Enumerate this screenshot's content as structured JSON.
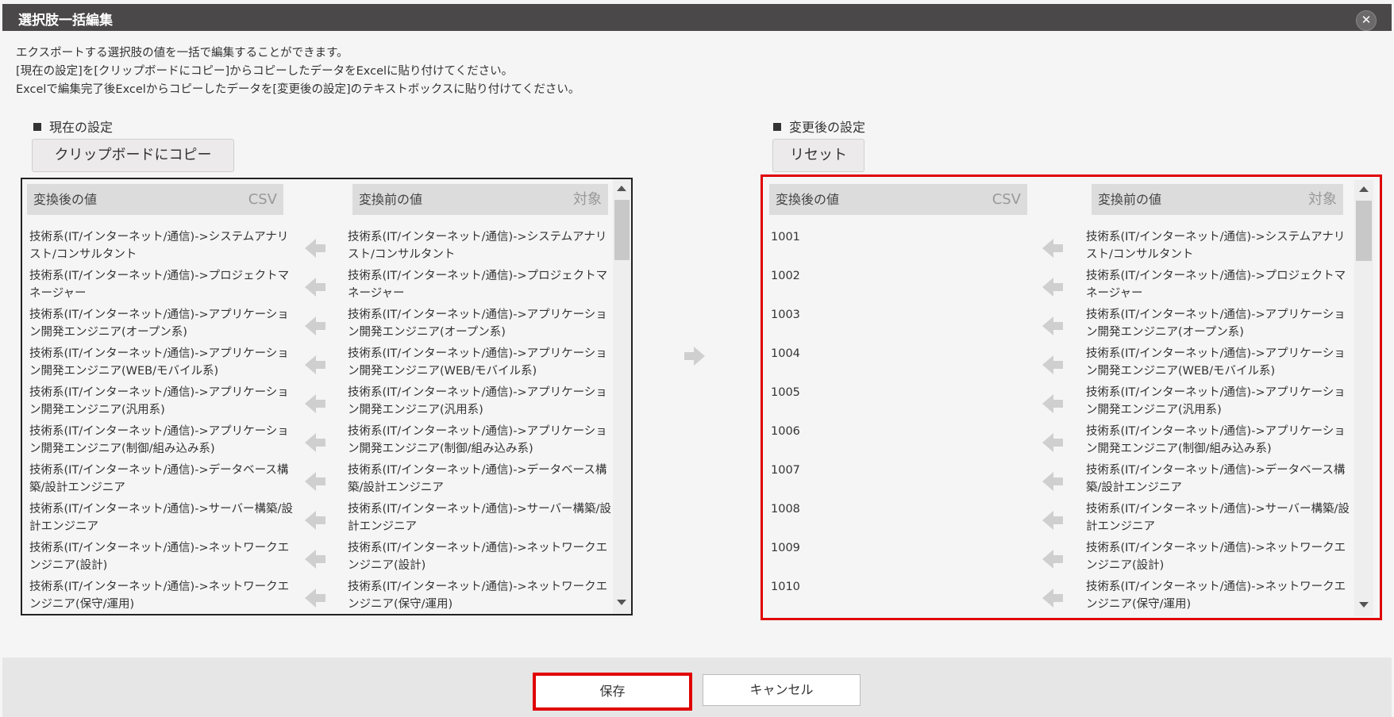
{
  "dialog": {
    "title": "選択肢一括編集",
    "close_icon": "close-icon"
  },
  "description": [
    "エクスポートする選択肢の値を一括で編集することができます。",
    "[現在の設定]を[クリップボードにコピー]からコピーしたデータをExcelに貼り付けてください。",
    "Excelで編集完了後Excelからコピーしたデータを[変更後の設定]のテキストボックスに貼り付けてください。"
  ],
  "current": {
    "section_title": "現在の設定",
    "button_label": "クリップボードにコピー",
    "header_after": "変換後の値",
    "header_after_tag": "CSV",
    "header_before": "変換前の値",
    "header_before_tag": "対象"
  },
  "changed": {
    "section_title": "変更後の設定",
    "button_label": "リセット",
    "header_after": "変換後の値",
    "header_after_tag": "CSV",
    "header_before": "変換前の値",
    "header_before_tag": "対象"
  },
  "rows": [
    {
      "before": "技術系(IT/インターネット/通信)->システムアナリスト/コンサルタント",
      "after_current": "技術系(IT/インターネット/通信)->システムアナリスト/コンサルタント",
      "after_new": "1001"
    },
    {
      "before": "技術系(IT/インターネット/通信)->プロジェクトマネージャー",
      "after_current": "技術系(IT/インターネット/通信)->プロジェクトマネージャー",
      "after_new": "1002"
    },
    {
      "before": "技術系(IT/インターネット/通信)->アプリケーション開発エンジニア(オープン系)",
      "after_current": "技術系(IT/インターネット/通信)->アプリケーション開発エンジニア(オープン系)",
      "after_new": "1003"
    },
    {
      "before": "技術系(IT/インターネット/通信)->アプリケーション開発エンジニア(WEB/モバイル系)",
      "after_current": "技術系(IT/インターネット/通信)->アプリケーション開発エンジニア(WEB/モバイル系)",
      "after_new": "1004"
    },
    {
      "before": "技術系(IT/インターネット/通信)->アプリケーション開発エンジニア(汎用系)",
      "after_current": "技術系(IT/インターネット/通信)->アプリケーション開発エンジニア(汎用系)",
      "after_new": "1005"
    },
    {
      "before": "技術系(IT/インターネット/通信)->アプリケーション開発エンジニア(制御/組み込み系)",
      "after_current": "技術系(IT/インターネット/通信)->アプリケーション開発エンジニア(制御/組み込み系)",
      "after_new": "1006"
    },
    {
      "before": "技術系(IT/インターネット/通信)->データベース構築/設計エンジニア",
      "after_current": "技術系(IT/インターネット/通信)->データベース構築/設計エンジニア",
      "after_new": "1007"
    },
    {
      "before": "技術系(IT/インターネット/通信)->サーバー構築/設計エンジニア",
      "after_current": "技術系(IT/インターネット/通信)->サーバー構築/設計エンジニア",
      "after_new": "1008"
    },
    {
      "before": "技術系(IT/インターネット/通信)->ネットワークエンジニア(設計)",
      "after_current": "技術系(IT/インターネット/通信)->ネットワークエンジニア(設計)",
      "after_new": "1009"
    },
    {
      "before": "技術系(IT/インターネット/通信)->ネットワークエンジニア(保守/運用)",
      "after_current": "技術系(IT/インターネット/通信)->ネットワークエンジニア(保守/運用)",
      "after_new": "1010"
    }
  ],
  "footer": {
    "save_label": "保存",
    "cancel_label": "キャンセル"
  },
  "colors": {
    "titlebar": "#4a4848",
    "highlight": "#e00000",
    "header_bg": "#dcdcdc",
    "arrow": "#cfcfcf"
  }
}
